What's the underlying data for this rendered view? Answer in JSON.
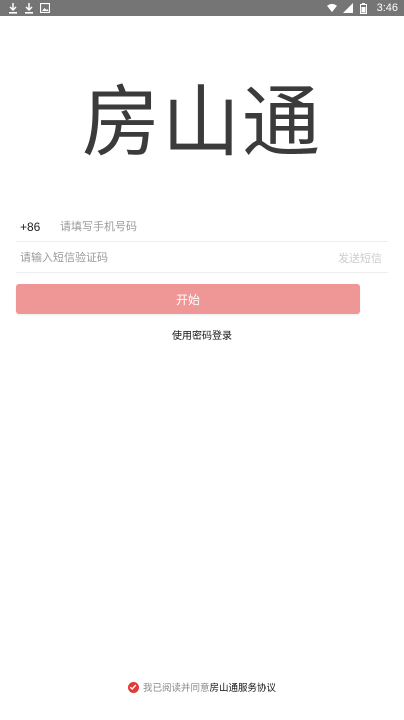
{
  "status_bar": {
    "left_icons": [
      "download-icon",
      "download-icon",
      "image-icon"
    ],
    "right_icons": [
      "wifi-icon",
      "signal-icon",
      "battery-icon"
    ],
    "time": "3:46",
    "background": "#757575"
  },
  "app": {
    "title": "房山通",
    "accent_color": "#ef9696"
  },
  "login_form": {
    "country_code": "+86",
    "phone_placeholder": "请填写手机号码",
    "code_placeholder": "请输入短信验证码",
    "send_code_label": "发送短信",
    "start_button_label": "开始",
    "password_login_label": "使用密码登录"
  },
  "agreement": {
    "prefix": "我已阅读并同意",
    "link": "房山通服务协议",
    "checked": true,
    "check_color": "#e53935"
  }
}
